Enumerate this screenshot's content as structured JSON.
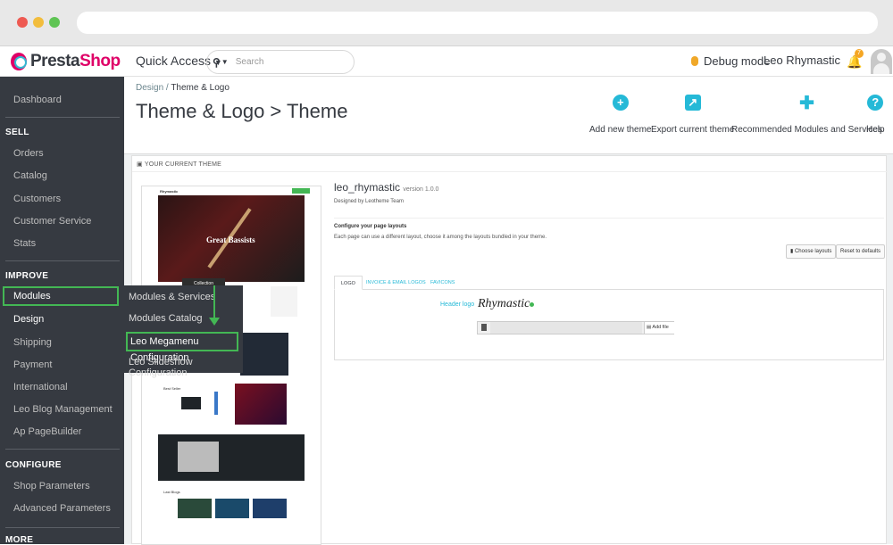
{
  "brand": {
    "name_a": "Presta",
    "name_b": "Shop"
  },
  "topbar": {
    "quick_access": "Quick Access",
    "search_placeholder": "Search",
    "debug": "Debug mode",
    "user": "Leo Rhymastic",
    "notif_count": "7"
  },
  "sidebar": {
    "dashboard": "Dashboard",
    "sell_head": "SELL",
    "orders": "Orders",
    "catalog": "Catalog",
    "customers": "Customers",
    "customer_service": "Customer Service",
    "stats": "Stats",
    "improve_head": "IMPROVE",
    "modules": "Modules",
    "design": "Design",
    "shipping": "Shipping",
    "payment": "Payment",
    "international": "International",
    "leo_blog": "Leo Blog Management",
    "ap_pagebuilder": "Ap PageBuilder",
    "configure_head": "CONFIGURE",
    "shop_params": "Shop Parameters",
    "adv_params": "Advanced Parameters",
    "more_head": "MORE"
  },
  "submenu": {
    "services": "Modules & Services",
    "catalog": "Modules Catalog",
    "megamenu": "Leo Megamenu Configuration",
    "slideshow": "Leo Slideshow Configuration"
  },
  "header": {
    "breadcrumb_1": "Design",
    "breadcrumb_sep": "/",
    "breadcrumb_2": "Theme & Logo",
    "title": "Theme & Logo > Theme",
    "btn_add": "Add new theme",
    "btn_export": "Export current theme",
    "btn_recommended": "Recommended Modules and Services",
    "btn_help": "Help"
  },
  "panel": {
    "heading": "YOUR CURRENT THEME",
    "theme_name": "leo_rhymastic",
    "version": "version 1.0.0",
    "designed_by": "Designed by Leotheme Team",
    "config_title": "Configure your page layouts",
    "config_desc": "Each page can use a different layout, choose it among the layouts bundled in your theme.",
    "choose_layouts": "Choose layouts",
    "reset_defaults": "Reset to defaults",
    "tabs": [
      "LOGO",
      "INVOICE & EMAIL LOGOS",
      "FAVICONS"
    ],
    "header_logo_label": "Header logo",
    "logo_text": "Rhymastic",
    "add_file": "Add file"
  },
  "preview": {
    "hero_text": "Great Bassists",
    "collection": "Collection",
    "best_seller": "Best Seller",
    "latest_blogs": "Last Blogs"
  }
}
